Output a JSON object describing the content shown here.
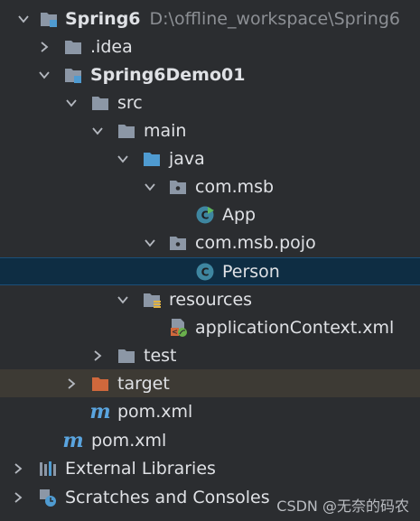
{
  "project": {
    "name": "Spring6",
    "path": "D:\\offline_workspace\\Spring6"
  },
  "tree": {
    "idea": ".idea",
    "module": "Spring6Demo01",
    "src": "src",
    "main": "main",
    "java": "java",
    "pkg1": "com.msb",
    "app": "App",
    "pkg2": "com.msb.pojo",
    "person": "Person",
    "resources": "resources",
    "appctx": "applicationContext.xml",
    "test": "test",
    "target": "target",
    "module_pom": "pom.xml",
    "root_pom": "pom.xml",
    "external_libs": "External Libraries",
    "scratches": "Scratches and Consoles"
  },
  "watermark": "CSDN @无奈的码农",
  "colors": {
    "background": "#2b2d30",
    "selected": "#0e2d43",
    "excluded": "#3d3a34",
    "folder": "#8c97a6",
    "source_folder": "#4f9bd1",
    "excluded_folder": "#d0683c",
    "class_icon": "#3e86a0"
  },
  "icons": {
    "chevron_open": "chevron-down-icon",
    "chevron_closed": "chevron-right-icon",
    "folder": "folder-icon",
    "module": "module-folder-icon",
    "package": "package-icon",
    "class": "class-icon",
    "xml": "spring-xml-icon",
    "maven": "maven-icon",
    "library": "library-icon",
    "scratch": "scratch-icon"
  }
}
